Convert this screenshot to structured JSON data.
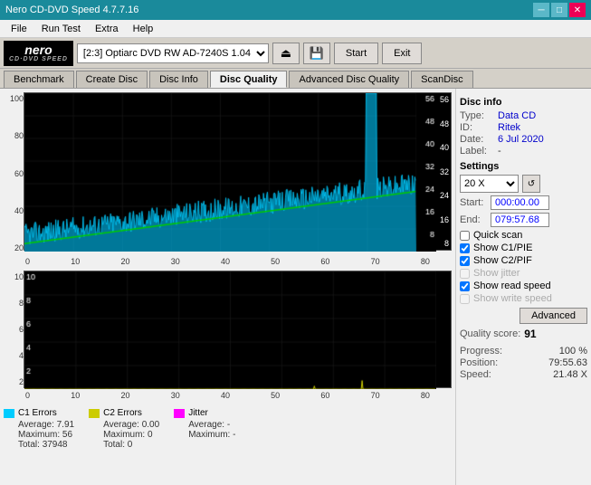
{
  "titlebar": {
    "title": "Nero CD-DVD Speed 4.7.7.16",
    "minimize": "─",
    "maximize": "□",
    "close": "✕"
  },
  "menubar": {
    "items": [
      "File",
      "Run Test",
      "Extra",
      "Help"
    ]
  },
  "toolbar": {
    "logo_nero": "nero",
    "logo_sub": "CD·DVD SPEED",
    "drive_label": "[2:3]  Optiarc DVD RW AD-7240S 1.04",
    "start_label": "Start",
    "exit_label": "Exit"
  },
  "tabs": [
    {
      "label": "Benchmark",
      "active": false
    },
    {
      "label": "Create Disc",
      "active": false
    },
    {
      "label": "Disc Info",
      "active": false
    },
    {
      "label": "Disc Quality",
      "active": true
    },
    {
      "label": "Advanced Disc Quality",
      "active": false
    },
    {
      "label": "ScanDisc",
      "active": false
    }
  ],
  "disc_info": {
    "section": "Disc info",
    "type_label": "Type:",
    "type_value": "Data CD",
    "id_label": "ID:",
    "id_value": "Ritek",
    "date_label": "Date:",
    "date_value": "6 Jul 2020",
    "label_label": "Label:",
    "label_value": "-"
  },
  "settings": {
    "section": "Settings",
    "speed_value": "20 X",
    "start_label": "Start:",
    "start_value": "000:00.00",
    "end_label": "End:",
    "end_value": "079:57.68",
    "quick_scan_label": "Quick scan",
    "c1pie_label": "Show C1/PIE",
    "c2pif_label": "Show C2/PIF",
    "jitter_label": "Show jitter",
    "read_speed_label": "Show read speed",
    "write_speed_label": "Show write speed",
    "advanced_label": "Advanced"
  },
  "quality": {
    "score_label": "Quality score:",
    "score_value": "91"
  },
  "progress": {
    "progress_label": "Progress:",
    "progress_value": "100 %",
    "position_label": "Position:",
    "position_value": "79:55.63",
    "speed_label": "Speed:",
    "speed_value": "21.48 X"
  },
  "legend": {
    "c1": {
      "label": "C1 Errors",
      "color": "#00ccff",
      "avg_label": "Average:",
      "avg_value": "7.91",
      "max_label": "Maximum:",
      "max_value": "56",
      "total_label": "Total:",
      "total_value": "37948"
    },
    "c2": {
      "label": "C2 Errors",
      "color": "#cccc00",
      "avg_label": "Average:",
      "avg_value": "0.00",
      "max_label": "Maximum:",
      "max_value": "0",
      "total_label": "Total:",
      "total_value": "0"
    },
    "jitter": {
      "label": "Jitter",
      "color": "#ff00ff",
      "avg_label": "Average:",
      "avg_value": "-",
      "max_label": "Maximum:",
      "max_value": "-"
    }
  },
  "upper_chart": {
    "y_labels": [
      "56",
      "48",
      "40",
      "32",
      "24",
      "16",
      "8"
    ],
    "x_labels": [
      "0",
      "10",
      "20",
      "30",
      "40",
      "50",
      "60",
      "70",
      "80"
    ],
    "left_y_labels": [
      "100",
      "80",
      "60",
      "40",
      "20"
    ]
  },
  "lower_chart": {
    "y_labels": [
      "10",
      "8",
      "6",
      "4",
      "2"
    ],
    "x_labels": [
      "0",
      "10",
      "20",
      "30",
      "40",
      "50",
      "60",
      "70",
      "80"
    ]
  }
}
